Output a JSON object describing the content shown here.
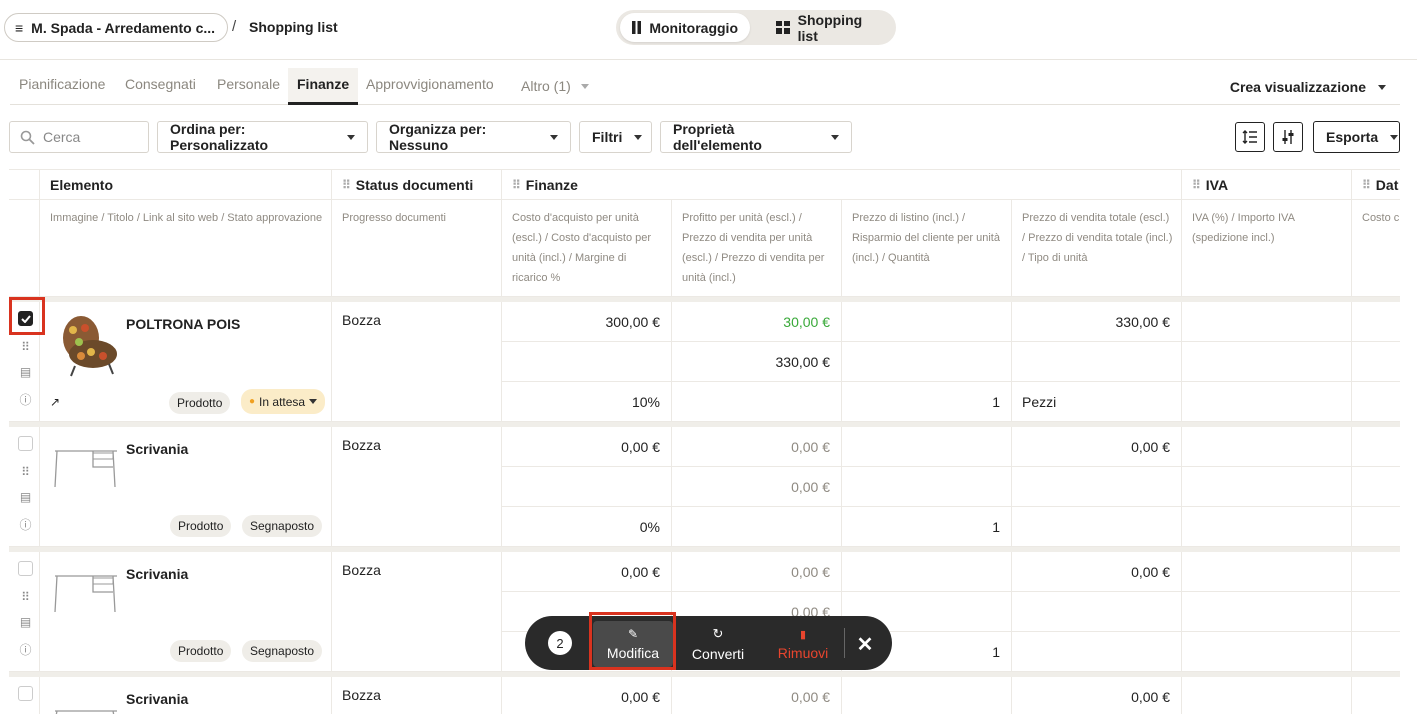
{
  "header": {
    "project": "M. Spada - Arredamento c...",
    "separator": "/",
    "breadcrumb": "Shopping list",
    "view_toggle": [
      "Monitoraggio",
      "Shopping list"
    ]
  },
  "tabs": [
    "Pianificazione",
    "Consegnati",
    "Personale",
    "Finanze",
    "Approvvigionamento",
    "Altro (1)"
  ],
  "active_tab": "Finanze",
  "create_view": "Crea visualizzazione",
  "toolbar": {
    "search_placeholder": "Cerca",
    "sort": "Ordina per: Personalizzato",
    "group": "Organizza per: Nessuno",
    "filters": "Filtri",
    "properties": "Proprietà dell'elemento",
    "export": "Esporta"
  },
  "columns": {
    "element": {
      "title": "Elemento",
      "sub": "Immagine / Titolo / Link al sito web / Stato approvazione"
    },
    "status": {
      "title": "Status documenti",
      "sub": "Progresso documenti"
    },
    "finance": {
      "title": "Finanze",
      "subs": [
        "Costo d'acquisto per unità (escl.) / Costo d'acquisto per unità (incl.) / Margine di ricarico %",
        "Profitto per unità (escl.) / Prezzo di vendita per unità (escl.) / Prezzo di vendita per unità (incl.)",
        "Prezzo di listino (incl.) / Risparmio del cliente per unità (incl.) / Quantità",
        "Prezzo di vendita totale (escl.) / Prezzo di vendita totale (incl.) / Tipo di unità"
      ]
    },
    "vat": {
      "title": "IVA",
      "sub": "IVA (%) / Importo IVA (spedizione incl.)"
    },
    "date": {
      "title": "Dat",
      "sub": "Costo c / Cost (incl.) / spedizi"
    }
  },
  "rows": [
    {
      "name": "POLTRONA POIS",
      "status": "Bozza",
      "type": "Prodotto",
      "approval": "In attesa",
      "cost_excl": "300,00 €",
      "profit": "30,00 €",
      "total_excl": "330,00 €",
      "sale_excl": "330,00 €",
      "margin": "10%",
      "qty": "1",
      "unit": "Pezzi"
    },
    {
      "name": "Scrivania",
      "status": "Bozza",
      "type": "Prodotto",
      "approval": "Segnaposto",
      "cost_excl": "0,00 €",
      "profit": "0,00 €",
      "total_excl": "0,00 €",
      "sale_excl": "0,00 €",
      "margin": "0%",
      "qty": "1",
      "unit": ""
    },
    {
      "name": "Scrivania",
      "status": "Bozza",
      "type": "Prodotto",
      "approval": "Segnaposto",
      "cost_excl": "0,00 €",
      "profit": "0,00 €",
      "total_excl": "0,00 €",
      "sale_excl": "0,00 €",
      "margin": "",
      "qty": "1",
      "unit": ""
    },
    {
      "name": "Scrivania",
      "status": "Bozza",
      "cost_excl": "0,00 €",
      "profit": "0,00 €",
      "total_excl": "0,00 €"
    }
  ],
  "selection_bar": {
    "count": "2",
    "edit": "Modifica",
    "convert": "Converti",
    "remove": "Rimuovi"
  },
  "colors": {
    "accent": "#222222",
    "green": "#39a939",
    "highlight": "#d9331f",
    "remove": "#e8452e",
    "waiting": "#fbecc8"
  }
}
